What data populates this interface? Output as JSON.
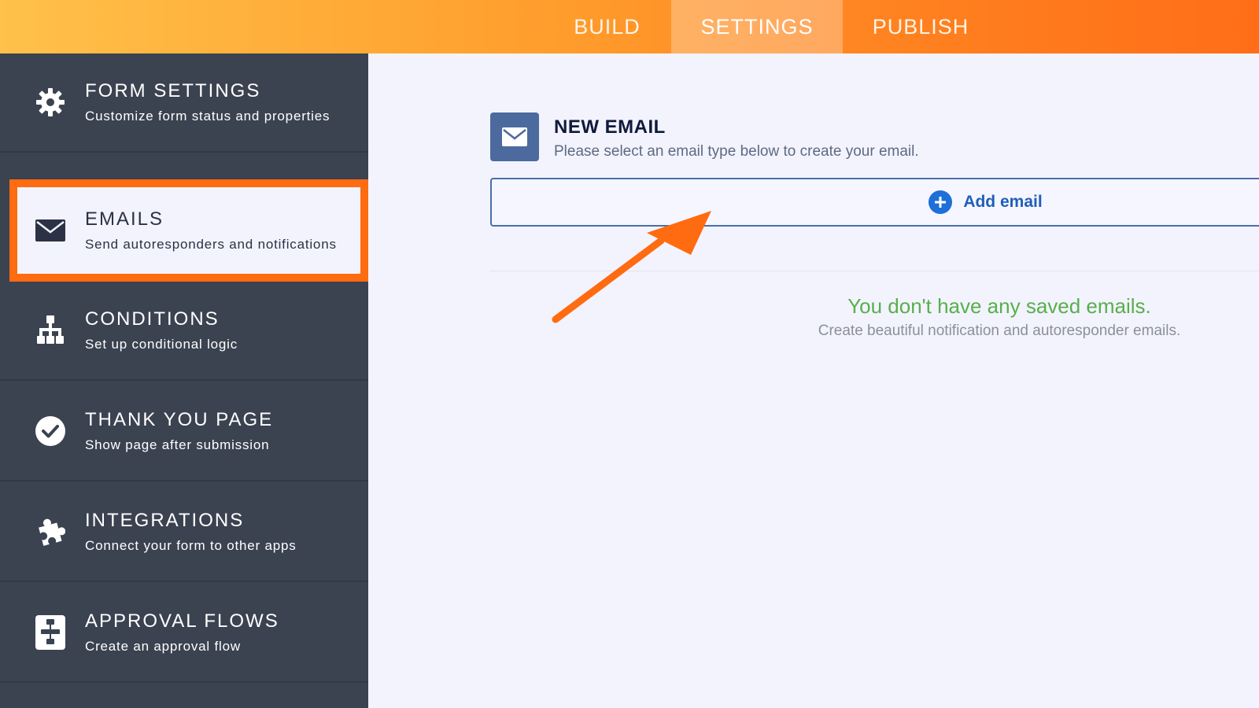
{
  "tabs": [
    {
      "label": "BUILD"
    },
    {
      "label": "SETTINGS"
    },
    {
      "label": "PUBLISH"
    }
  ],
  "active_tab": "SETTINGS",
  "sidebar": {
    "items": [
      {
        "title": "FORM SETTINGS",
        "subtitle": "Customize form status and properties",
        "icon": "gear-icon"
      },
      {
        "title": "EMAILS",
        "subtitle": "Send autoresponders and notifications",
        "icon": "envelope-icon"
      },
      {
        "title": "CONDITIONS",
        "subtitle": "Set up conditional logic",
        "icon": "hierarchy-icon"
      },
      {
        "title": "THANK YOU PAGE",
        "subtitle": "Show page after submission",
        "icon": "check-circle-icon"
      },
      {
        "title": "INTEGRATIONS",
        "subtitle": "Connect your form to other apps",
        "icon": "puzzle-icon"
      },
      {
        "title": "APPROVAL FLOWS",
        "subtitle": "Create an approval flow",
        "icon": "flow-icon"
      }
    ],
    "active": "EMAILS"
  },
  "main": {
    "new_email_title": "NEW EMAIL",
    "new_email_subtitle": "Please select an email type below to create your email.",
    "add_email_label": "Add email",
    "empty_title": "You don't have any saved emails.",
    "empty_subtitle": "Create beautiful notification and autoresponder emails."
  },
  "colors": {
    "topbar_start": "#ffc14a",
    "topbar_end": "#ff6e17",
    "sidebar_bg": "#3b4250",
    "highlight": "#ff6b10",
    "accent_blue": "#1f6fd8",
    "empty_green": "#57b04a"
  }
}
